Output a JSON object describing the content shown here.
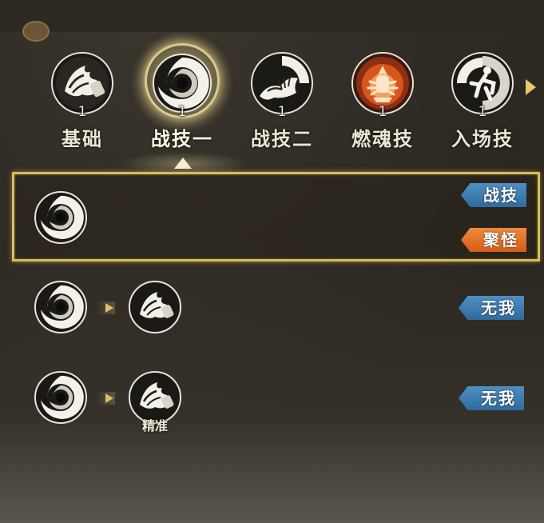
{
  "skill_tabs": [
    {
      "label": "基础",
      "level": "1",
      "icon": "dragon-claw-icon",
      "active": false
    },
    {
      "label": "战技一",
      "level": "1",
      "icon": "vortex-icon",
      "active": true
    },
    {
      "label": "战技二",
      "level": "1",
      "icon": "grasping-hand-icon",
      "active": false
    },
    {
      "label": "燃魂技",
      "level": "1",
      "icon": "flaming-idol-icon",
      "active": false
    },
    {
      "label": "入场技",
      "level": "1",
      "icon": "leaping-figure-icon",
      "active": false
    }
  ],
  "combos": [
    {
      "sequence": [
        "vortex-icon"
      ],
      "tags": [
        {
          "text": "战技",
          "color": "blue"
        },
        {
          "text": "聚怪",
          "color": "orange"
        }
      ],
      "selected": true
    },
    {
      "sequence": [
        "vortex-icon",
        "dragon-claw-icon"
      ],
      "tags": [
        {
          "text": "无我",
          "color": "blue"
        }
      ],
      "selected": false
    },
    {
      "sequence": [
        "vortex-icon",
        "dragon-claw-icon"
      ],
      "caption": "精准",
      "tags": [
        {
          "text": "无我",
          "color": "blue"
        }
      ],
      "selected": false
    }
  ],
  "colors": {
    "selected_border": "#d9bd58",
    "tag_blue": "#3f7db3",
    "tag_orange": "#e4722a",
    "active_glow": "#fff0aa"
  }
}
